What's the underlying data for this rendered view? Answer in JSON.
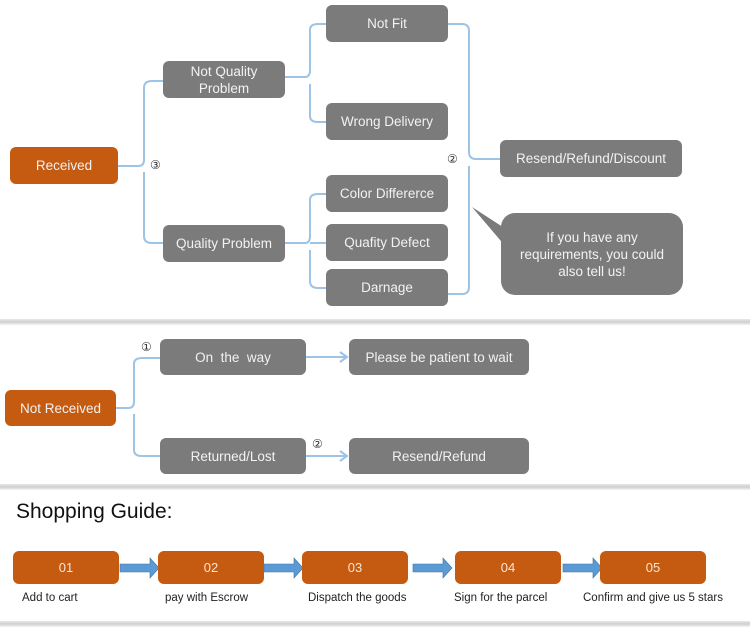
{
  "received_section": {
    "root": "Received",
    "root_marker": "③",
    "branches": [
      {
        "label": "Not Quality Problem",
        "label_lines": [
          "Not Quality",
          "Problem"
        ],
        "children": [
          "Not Fit",
          "Wrong Delivery"
        ]
      },
      {
        "label": "Quality Problem",
        "children": [
          "Color Differerce",
          "Quafity Defect",
          "Darnage"
        ]
      }
    ],
    "outcome_marker": "②",
    "outcome": "Resend/Refund/Discount",
    "callout_lines": [
      "If you have any",
      "requirements, you could",
      "also tell us!"
    ]
  },
  "not_received_section": {
    "root": "Not Received",
    "branches": [
      {
        "marker": "①",
        "label": "On  the  way",
        "outcome": "Please be patient to wait"
      },
      {
        "marker": "②",
        "label": "Returned/Lost",
        "outcome": "Resend/Refund"
      }
    ]
  },
  "shopping_guide": {
    "title": "Shopping Guide:",
    "steps": [
      {
        "number": "01",
        "label": "Add to cart"
      },
      {
        "number": "02",
        "label": "pay with Escrow"
      },
      {
        "number": "03",
        "label": "Dispatch the goods"
      },
      {
        "number": "04",
        "label": "Sign for the parcel"
      },
      {
        "number": "05",
        "label": "Confirm and give us 5 stars"
      }
    ]
  },
  "colors": {
    "accent_orange": "#c55a11",
    "node_gray": "#7b7b7b",
    "connector_blue": "#9dc3e6",
    "arrow_blue": "#5b9bd5"
  }
}
